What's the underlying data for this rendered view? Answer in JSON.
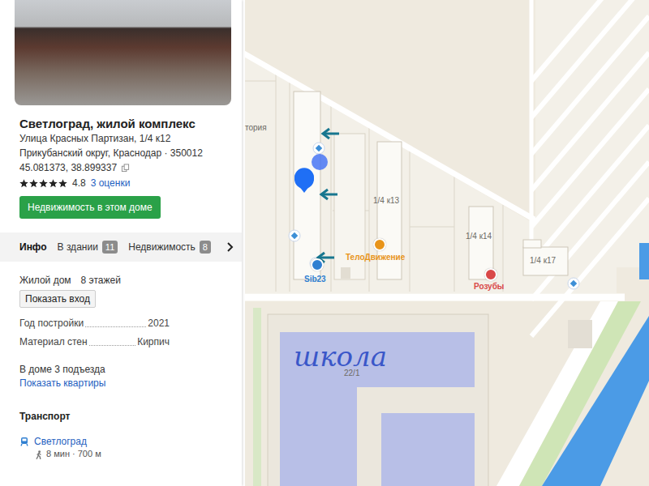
{
  "card": {
    "title": "Светлоград, жилой комплекс",
    "address": "Улица Красных Партизан, 1/4 к12",
    "district": "Прикубанский округ, Краснодар · 350012",
    "coords": "45.081373, 38.899337",
    "rating": {
      "stars": 5,
      "value": "4.8",
      "count": "3 оценки"
    },
    "realty_button": "Недвижимость в этом доме"
  },
  "tabs": [
    {
      "label": "Инфо",
      "selected": true
    },
    {
      "label": "В здании",
      "badge": "11",
      "selected": false
    },
    {
      "label": "Недвижимость",
      "badge": "8",
      "selected": false
    }
  ],
  "info": {
    "type": "Жилой дом",
    "floors": "8 этажей",
    "entrance_button": "Показать вход",
    "facts": [
      {
        "label": "Год постройки",
        "value": "2021"
      },
      {
        "label": "Материал стен",
        "value": "Кирпич"
      }
    ],
    "entrances": "В доме 3 подъезда",
    "apartments_link": "Показать квартиры"
  },
  "transport": {
    "heading": "Транспорт",
    "stops": [
      {
        "name": "Светлоград",
        "walk": "8 мин · 700 м"
      }
    ]
  },
  "map": {
    "labels": [
      "тория",
      "1/4 к13",
      "1/4 к14",
      "1/4 к17",
      "22/1"
    ],
    "pois": [
      {
        "name": "ТелоДвижение",
        "color": "#e8941a"
      },
      {
        "name": "Sib23",
        "color": "#2f7fd1"
      },
      {
        "name": "Розубы",
        "color": "#d94848"
      }
    ],
    "annotation": "школа"
  }
}
